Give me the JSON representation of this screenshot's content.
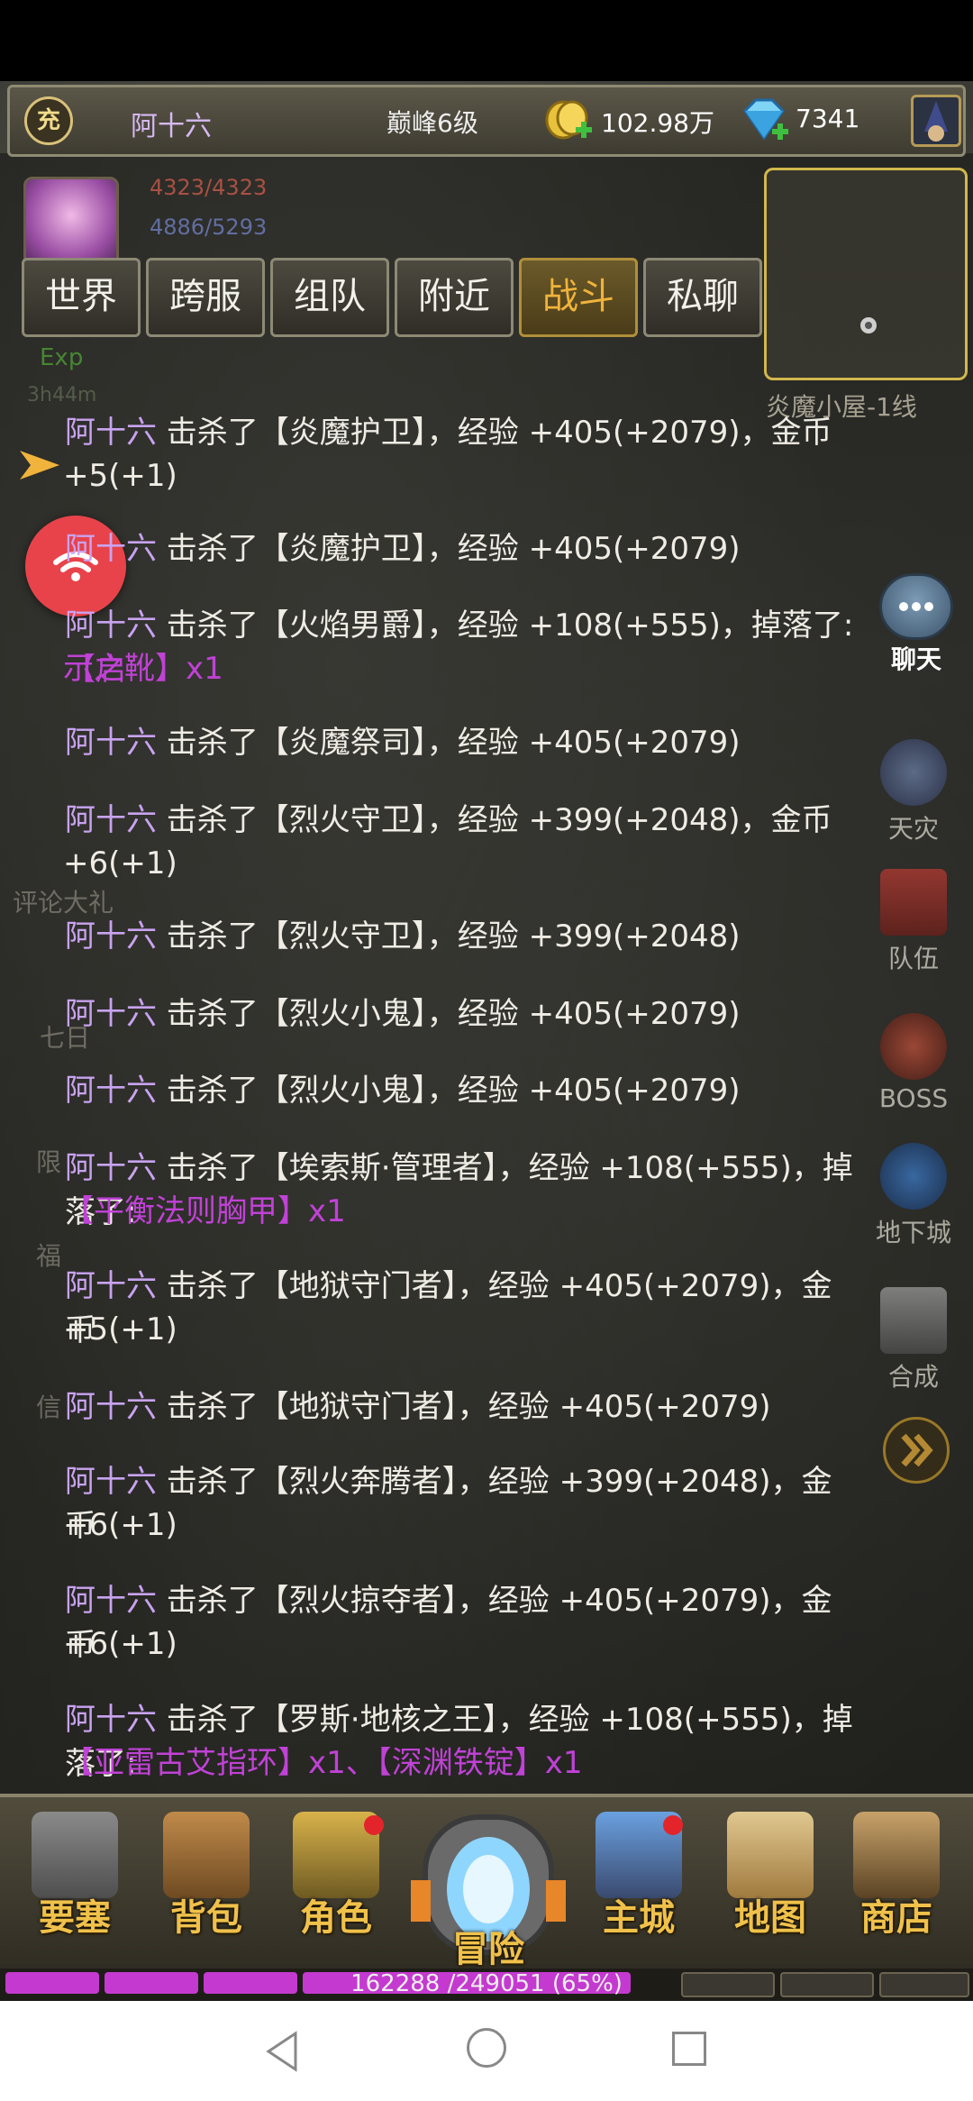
{
  "top_bar": {
    "charge_label": "充",
    "player_name": "阿十六",
    "peak_level": "巅峰6级",
    "gold": "102.98万",
    "diamonds": "7341"
  },
  "player": {
    "hp": "4323/4323",
    "mp": "4886/5293",
    "exp_label": "Exp",
    "timer": "3h44m"
  },
  "minimap": {
    "map_name": "炎魔小屋-1线"
  },
  "tabs": [
    {
      "label": "世界",
      "active": false
    },
    {
      "label": "跨服",
      "active": false
    },
    {
      "label": "组队",
      "active": false
    },
    {
      "label": "附近",
      "active": false
    },
    {
      "label": "战斗",
      "active": true
    },
    {
      "label": "私聊",
      "active": false
    }
  ],
  "messages": [
    {
      "name": "阿十六",
      "text": " 击杀了【炎魔护卫】，经验 +405(+2079)，金币",
      "cont": "+5(+1)"
    },
    {
      "name": "阿十六",
      "text": " 击杀了【炎魔护卫】，经验 +405(+2079)"
    },
    {
      "name": "阿十六",
      "text": " 击杀了【火焰男爵】，经验 +108(+555)，掉落了:",
      "item": "【启",
      "cont_item": "示之靴】x1"
    },
    {
      "name": "阿十六",
      "text": " 击杀了【炎魔祭司】，经验 +405(+2079)"
    },
    {
      "name": "阿十六",
      "text": " 击杀了【烈火守卫】，经验 +399(+2048)，金币",
      "cont": "+6(+1)"
    },
    {
      "name": "阿十六",
      "text": " 击杀了【烈火守卫】，经验 +399(+2048)"
    },
    {
      "name": "阿十六",
      "text": " 击杀了【烈火小鬼】，经验 +405(+2079)"
    },
    {
      "name": "阿十六",
      "text": " 击杀了【烈火小鬼】，经验 +405(+2079)"
    },
    {
      "name": "阿十六",
      "text": " 击杀了【埃索斯·管理者】，经验 +108(+555)，掉落了:",
      "cont_item": "【平衡法则胸甲】x1"
    },
    {
      "name": "阿十六",
      "text": " 击杀了【地狱守门者】，经验 +405(+2079)，金币",
      "cont": "+5(+1)"
    },
    {
      "name": "阿十六",
      "text": " 击杀了【地狱守门者】，经验 +405(+2079)"
    },
    {
      "name": "阿十六",
      "text": " 击杀了【烈火奔腾者】，经验 +399(+2048)，金币",
      "cont": "+6(+1)"
    },
    {
      "name": "阿十六",
      "text": " 击杀了【烈火掠夺者】，经验 +405(+2079)，金币",
      "cont": "+6(+1)"
    },
    {
      "name": "阿十六",
      "text": " 击杀了【罗斯·地核之王】，经验 +108(+555)，掉落了:",
      "cont_item": "【亚雷古艾指环】x1、【深渊铁锭】x1"
    }
  ],
  "side_buttons": {
    "chat": "聊天",
    "tianzai": "天灾",
    "team": "队伍",
    "boss": "BOSS",
    "dungeon": "地下城",
    "synth": "合成"
  },
  "left_ghost": {
    "review": "评论大礼",
    "seven": "七日",
    "limit": "限",
    "welfare": "福",
    "letter": "信"
  },
  "bottom_nav": [
    {
      "label": "要塞",
      "badge": false
    },
    {
      "label": "背包",
      "badge": false
    },
    {
      "label": "角色",
      "badge": true
    },
    {
      "label": "冒险",
      "badge": false
    },
    {
      "label": "主城",
      "badge": true
    },
    {
      "label": "地图",
      "badge": false
    },
    {
      "label": "商店",
      "badge": false
    }
  ],
  "exp_bar": {
    "text": "162288 /249051 (65%)",
    "percent": 65
  },
  "colors": {
    "name_purple": "#c8a3f0",
    "item_magenta": "#c042d6",
    "active_tab": "#f0b33b",
    "nav_label": "#f0c14a",
    "exp_fill": "#c43ad0"
  }
}
